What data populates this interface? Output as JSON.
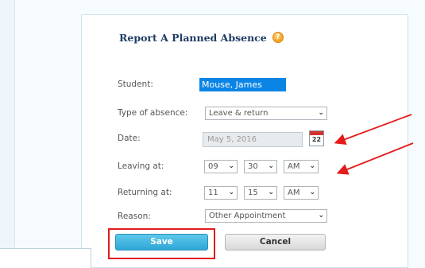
{
  "dialog": {
    "title": "Report A Planned Absence",
    "help_icon": "help-icon",
    "fields": {
      "student": {
        "label": "Student:",
        "value": "Mouse, James"
      },
      "type_of_absence": {
        "label": "Type of absence:",
        "value": "Leave & return"
      },
      "date": {
        "label": "Date:",
        "value": "May 5, 2016",
        "calendar_icon": "calendar-icon",
        "calendar_day": "22"
      },
      "leaving_at": {
        "label": "Leaving at:",
        "hour": "09",
        "minute": "30",
        "ampm": "AM"
      },
      "returning_at": {
        "label": "Returning at:",
        "hour": "11",
        "minute": "15",
        "ampm": "AM"
      },
      "reason": {
        "label": "Reason:",
        "value": "Other Appointment"
      }
    },
    "buttons": {
      "save": "Save",
      "cancel": "Cancel"
    }
  },
  "annotations": {
    "color": "#e41b1b",
    "arrow_count": 2,
    "highlight": "save-button"
  }
}
